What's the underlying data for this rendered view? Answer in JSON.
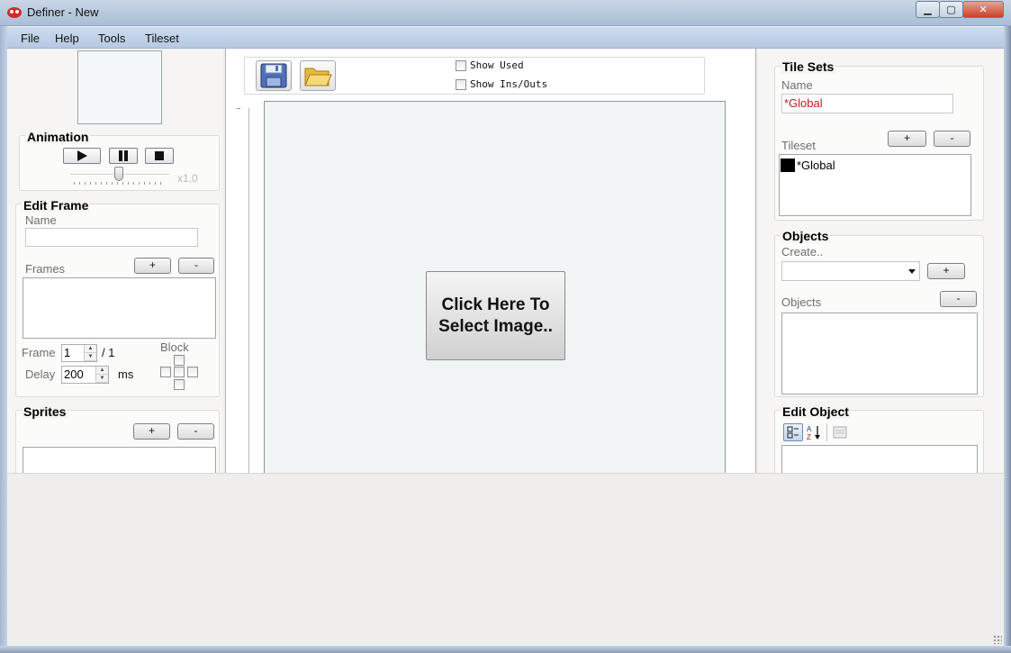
{
  "window": {
    "title": "Definer - New",
    "minimize": "▁",
    "maximize": "▢",
    "close": "✕"
  },
  "menu": [
    "File",
    "Help",
    "Tools",
    "Tileset"
  ],
  "animation": {
    "title": "Animation",
    "speed_label": "x1,0",
    "speed_level": 0.5,
    "play_icon": "play-icon",
    "pause_icon": "pause-icon",
    "stop_icon": "stop-icon"
  },
  "edit_frame": {
    "title": "Edit Frame",
    "name_label": "Name",
    "name_value": "",
    "frames_label": "Frames",
    "add": "+",
    "remove": "-",
    "frame_label": "Frame",
    "frame_value": "1",
    "frame_total": "/ 1",
    "delay_label": "Delay",
    "delay_value": "200",
    "delay_unit": "ms",
    "block_label": "Block"
  },
  "sprites": {
    "title": "Sprites",
    "add": "+",
    "remove": "-"
  },
  "toolbar": {
    "save_icon": "floppy-disk-icon",
    "open_icon": "folder-open-icon",
    "show_used": "Show Used",
    "show_ins_outs": "Show Ins/Outs"
  },
  "canvas": {
    "select_image_label_1": "Click Here To",
    "select_image_label_2": "Select Image.."
  },
  "tile_sets": {
    "title": "Tile Sets",
    "name_label": "Name",
    "name_value": "*Global",
    "tileset_label": "Tileset",
    "add": "+",
    "remove": "-",
    "items": [
      "*Global"
    ]
  },
  "objects": {
    "title": "Objects",
    "create_label": "Create..",
    "create_value": "",
    "objects_label": "Objects",
    "add": "+",
    "remove": "-"
  },
  "edit_object": {
    "title": "Edit Object"
  },
  "colors": {
    "accent": "#c9151e",
    "titlebar": "#b6c9e1"
  }
}
